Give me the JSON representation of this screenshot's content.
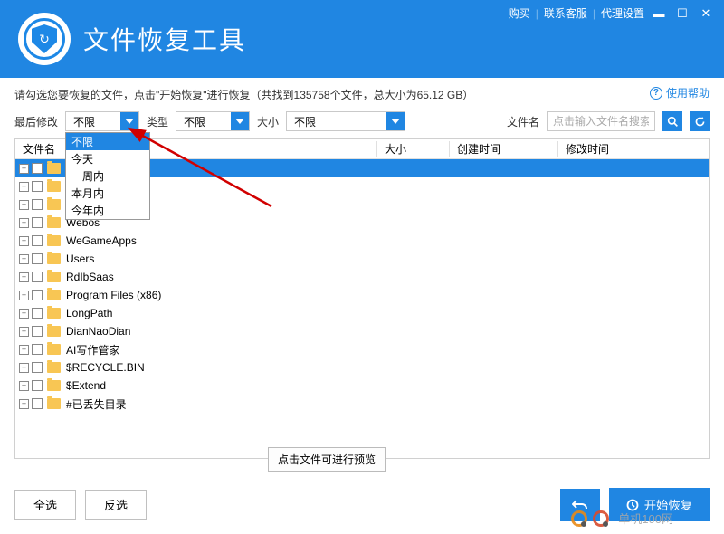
{
  "header": {
    "links": {
      "buy": "购买",
      "contact": "联系客服",
      "proxy": "代理设置"
    },
    "title": "文件恢复工具"
  },
  "instruct": "请勾选您要恢复的文件，点击\"开始恢复\"进行恢复（共找到135758个文件，总大小为65.12 GB）",
  "help": "使用帮助",
  "filters": {
    "last_mod_label": "最后修改",
    "last_mod_value": "不限",
    "type_label": "类型",
    "type_value": "不限",
    "size_label": "大小",
    "size_value": "不限",
    "name_label": "文件名",
    "search_placeholder": "点击输入文件名搜索",
    "dropdown_options": [
      "不限",
      "今天",
      "一周内",
      "本月内",
      "今年内"
    ]
  },
  "columns": {
    "name": "文件名",
    "size": "大小",
    "created": "创建时间",
    "modified": "修改时间"
  },
  "rows": [
    {
      "name": "",
      "highlight": true
    },
    {
      "name": ""
    },
    {
      "name": ""
    },
    {
      "name": "Webos"
    },
    {
      "name": "WeGameApps"
    },
    {
      "name": "Users"
    },
    {
      "name": "RdIbSaas"
    },
    {
      "name": "Program Files (x86)"
    },
    {
      "name": "LongPath"
    },
    {
      "name": "DianNaoDian"
    },
    {
      "name": "AI写作管家"
    },
    {
      "name": "$RECYCLE.BIN"
    },
    {
      "name": "$Extend"
    },
    {
      "name": "#已丢失目录"
    }
  ],
  "hint": "点击文件可进行预览",
  "footer": {
    "select_all": "全选",
    "invert": "反选",
    "start": "开始恢复"
  },
  "watermark": "单机100网"
}
